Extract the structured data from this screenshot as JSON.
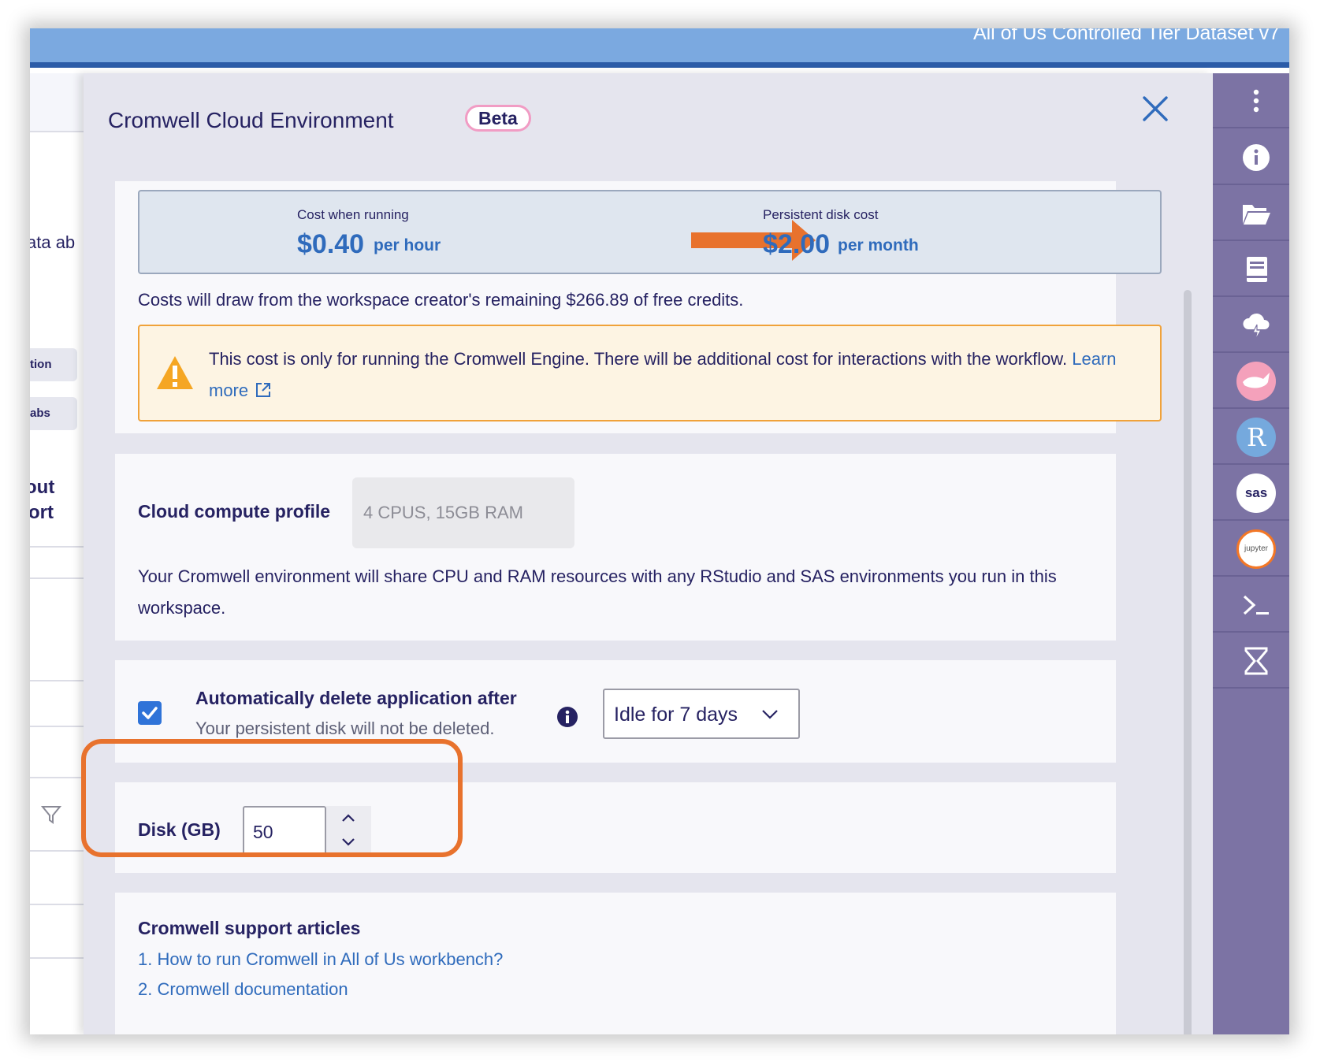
{
  "header": {
    "dataset_title": "All of Us Controlled Tier Dataset v7"
  },
  "background_page": {
    "fragments": [
      "ata ab",
      "tion",
      "abs",
      "out",
      "ort"
    ]
  },
  "modal": {
    "title": "Cromwell Cloud Environment",
    "badge": "Beta",
    "cost": {
      "running_label": "Cost when running",
      "running_value": "$0.40",
      "running_unit": "per hour",
      "disk_label": "Persistent disk cost",
      "disk_value": "$2.00",
      "disk_unit": "per month"
    },
    "credits_text": "Costs will draw from the workspace creator's remaining $266.89 of free credits.",
    "warning": {
      "text": "This cost is only for running the Cromwell Engine. There will be additional cost for interactions with the workflow.",
      "link": "Learn more"
    },
    "compute": {
      "label": "Cloud compute profile",
      "value": "4 CPUS, 15GB RAM",
      "note": "Your Cromwell environment will share CPU and RAM resources with any RStudio and SAS environments you run in this workspace."
    },
    "auto_delete": {
      "checked": true,
      "label": "Automatically delete application after",
      "sublabel": "Your persistent disk will not be deleted.",
      "selected": "Idle for 7 days"
    },
    "disk": {
      "label": "Disk (GB)",
      "value": "50"
    },
    "support": {
      "title": "Cromwell support articles",
      "links": [
        "1. How to run Cromwell in All of Us workbench?",
        "2. Cromwell documentation"
      ]
    }
  },
  "sidebar": {
    "icons": [
      "more-vertical-icon",
      "info-icon",
      "folder-icon",
      "notebook-icon",
      "cloud-compute-icon",
      "cromwell-icon",
      "rstudio-icon",
      "sas-icon",
      "jupyter-icon",
      "terminal-icon",
      "hourglass-icon"
    ],
    "labels": {
      "rstudio": "R",
      "sas": "sas",
      "jupyter": "jupyter"
    }
  },
  "colors": {
    "accent_blue": "#2f6bbc",
    "header_blue": "#7ba9e0",
    "sidebar_purple": "#7c73a4",
    "highlight_orange": "#e8722d",
    "warning_orange": "#f0a23a"
  }
}
